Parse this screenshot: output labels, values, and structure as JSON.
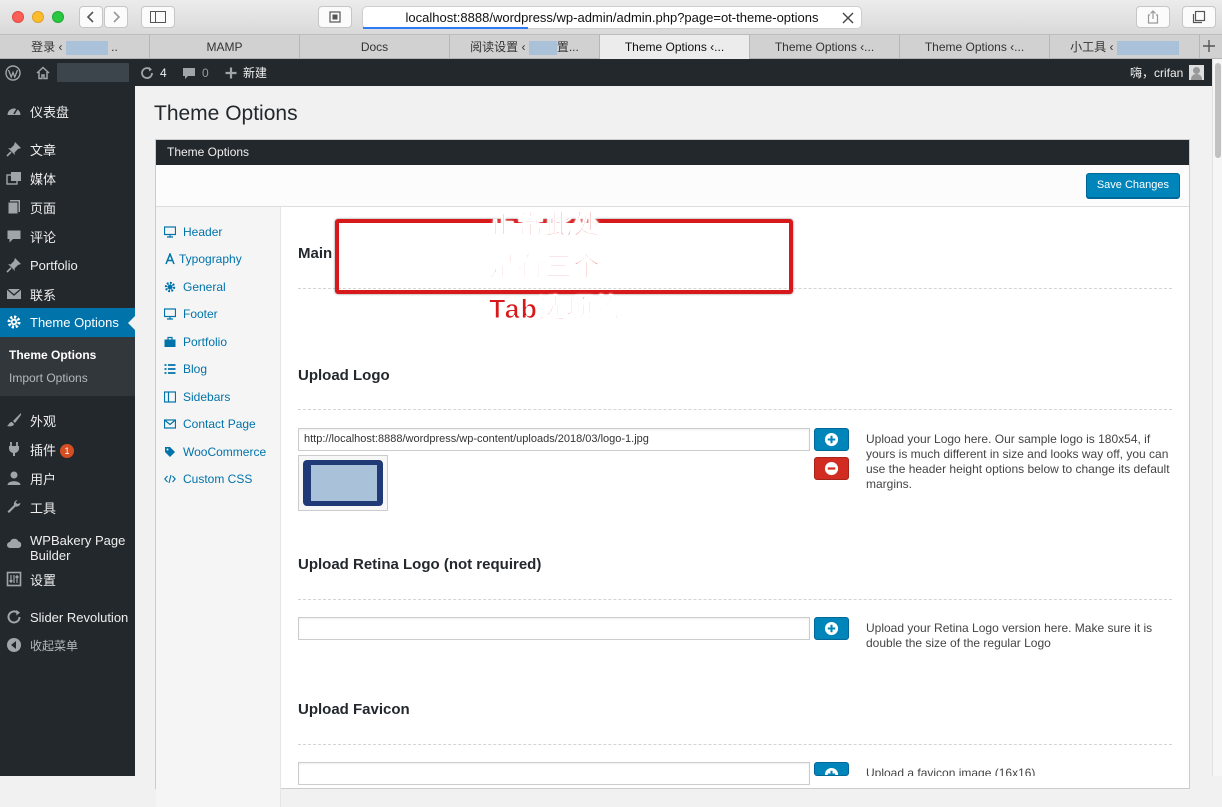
{
  "browser": {
    "url": "localhost:8888/wordpress/wp-admin/admin.php?page=ot-theme-options",
    "tabs": [
      {
        "label": "登录 ‹ ",
        "suffix": " ..",
        "blurred": true
      },
      {
        "label": "MAMP"
      },
      {
        "label": "Docs"
      },
      {
        "label": "阅读设置 ‹ ",
        "suffix": "置...",
        "blurred": true
      },
      {
        "label": "Theme Options ‹..."
      },
      {
        "label": "Theme Options ‹..."
      },
      {
        "label": "Theme Options ‹..."
      },
      {
        "label": "小工具 ‹ ",
        "suffix": "",
        "blurred": true
      }
    ]
  },
  "adminbar": {
    "updates": "4",
    "comments": "0",
    "new": "新建",
    "greeting": "嗨，crifan"
  },
  "sidebar": {
    "items": [
      {
        "label": "仪表盘",
        "icon": "dashboard-icon"
      },
      {
        "label": "文章",
        "icon": "pin-icon"
      },
      {
        "label": "媒体",
        "icon": "media-icon"
      },
      {
        "label": "页面",
        "icon": "page-icon"
      },
      {
        "label": "评论",
        "icon": "comment-icon"
      },
      {
        "label": "Portfolio",
        "icon": "pin-icon"
      },
      {
        "label": "联系",
        "icon": "mail-icon"
      },
      {
        "label": "Theme Options",
        "icon": "gear-icon"
      },
      {
        "label": "外观",
        "icon": "brush-icon"
      },
      {
        "label": "插件",
        "icon": "plugin-icon",
        "badge": "1"
      },
      {
        "label": "用户",
        "icon": "user-icon"
      },
      {
        "label": "工具",
        "icon": "wrench-icon"
      },
      {
        "label": "WPBakery Page Builder",
        "icon": "cloud-icon"
      },
      {
        "label": "设置",
        "icon": "settings-icon"
      },
      {
        "label": "Slider Revolution",
        "icon": "refresh-icon"
      },
      {
        "label": "收起菜单",
        "icon": "collapse-icon"
      }
    ],
    "submenu": [
      "Theme Options",
      "Import Options"
    ]
  },
  "page": {
    "title": "Theme Options",
    "panel_title": "Theme Options",
    "save_label": "Save Changes"
  },
  "option_nav": [
    {
      "label": "Header",
      "icon": "monitor-icon"
    },
    {
      "label": "Typography",
      "icon": "typography-icon"
    },
    {
      "label": "General",
      "icon": "gear-icon"
    },
    {
      "label": "Footer",
      "icon": "monitor-icon"
    },
    {
      "label": "Portfolio",
      "icon": "briefcase-icon"
    },
    {
      "label": "Blog",
      "icon": "list-icon"
    },
    {
      "label": "Sidebars",
      "icon": "columns-icon"
    },
    {
      "label": "Contact Page",
      "icon": "envelope-icon"
    },
    {
      "label": "WooCommerce",
      "icon": "tag-icon"
    },
    {
      "label": "Custom CSS",
      "icon": "code-icon"
    }
  ],
  "sections": {
    "main": "Main",
    "logo": {
      "title": "Upload Logo",
      "value": "http://localhost:8888/wordpress/wp-content/uploads/2018/03/logo-1.jpg",
      "desc": "Upload your Logo here. Our sample logo is 180x54, if yours is much different in size and looks way off, you can use the header height options below to change its default margins."
    },
    "retina": {
      "title": "Upload Retina Logo (not required)",
      "value": "",
      "desc": "Upload your Retina Logo version here. Make sure it is double the size of the regular Logo"
    },
    "favicon": {
      "title": "Upload Favicon",
      "desc": "Upload a favicon image (16x16)"
    }
  },
  "annotation": {
    "lines": [
      "正常此处",
      "是有三个",
      "Tab选项的"
    ],
    "color": "#d7191c"
  }
}
